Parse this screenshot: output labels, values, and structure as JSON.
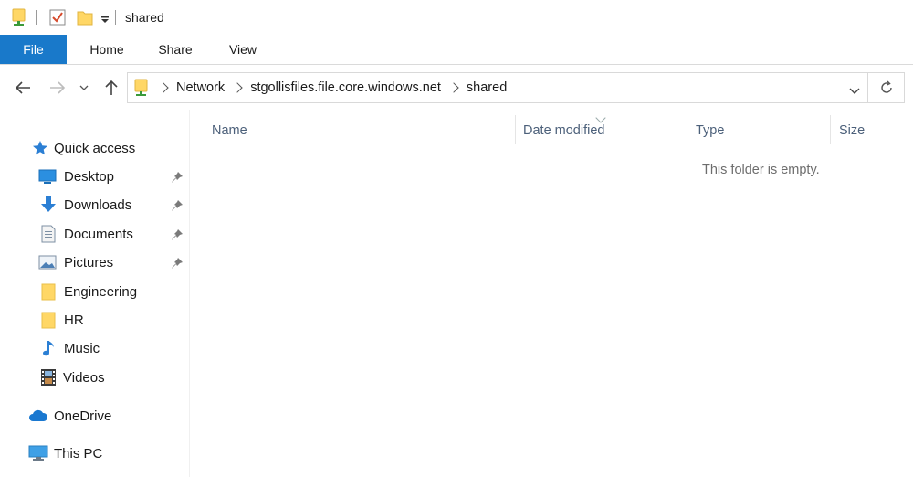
{
  "window": {
    "title": "shared",
    "quick_access_toolbar": [
      "properties-icon",
      "new-folder-icon",
      "customize-dropdown-icon"
    ]
  },
  "ribbon": {
    "tabs": [
      {
        "label": "File",
        "active": true
      },
      {
        "label": "Home"
      },
      {
        "label": "Share"
      },
      {
        "label": "View"
      }
    ]
  },
  "address_bar": {
    "breadcrumbs": [
      "Network",
      "stgollisfiles.file.core.windows.net",
      "shared"
    ]
  },
  "sidebar": {
    "quick_access": {
      "label": "Quick access"
    },
    "items": [
      {
        "label": "Desktop",
        "icon": "desktop-icon",
        "pinned": true
      },
      {
        "label": "Downloads",
        "icon": "downloads-icon",
        "pinned": true
      },
      {
        "label": "Documents",
        "icon": "documents-icon",
        "pinned": true
      },
      {
        "label": "Pictures",
        "icon": "pictures-icon",
        "pinned": true
      },
      {
        "label": "Engineering",
        "icon": "folder-icon",
        "pinned": false
      },
      {
        "label": "HR",
        "icon": "folder-icon",
        "pinned": false
      },
      {
        "label": "Music",
        "icon": "music-icon",
        "pinned": false
      },
      {
        "label": "Videos",
        "icon": "videos-icon",
        "pinned": false
      }
    ],
    "onedrive": {
      "label": "OneDrive"
    },
    "this_pc": {
      "label": "This PC"
    }
  },
  "content": {
    "columns": [
      "Name",
      "Date modified",
      "Type",
      "Size"
    ],
    "empty_message": "This folder is empty."
  },
  "colors": {
    "accent": "#1979ca",
    "folder": "#ffd766",
    "column_header_text": "#4c607a"
  }
}
